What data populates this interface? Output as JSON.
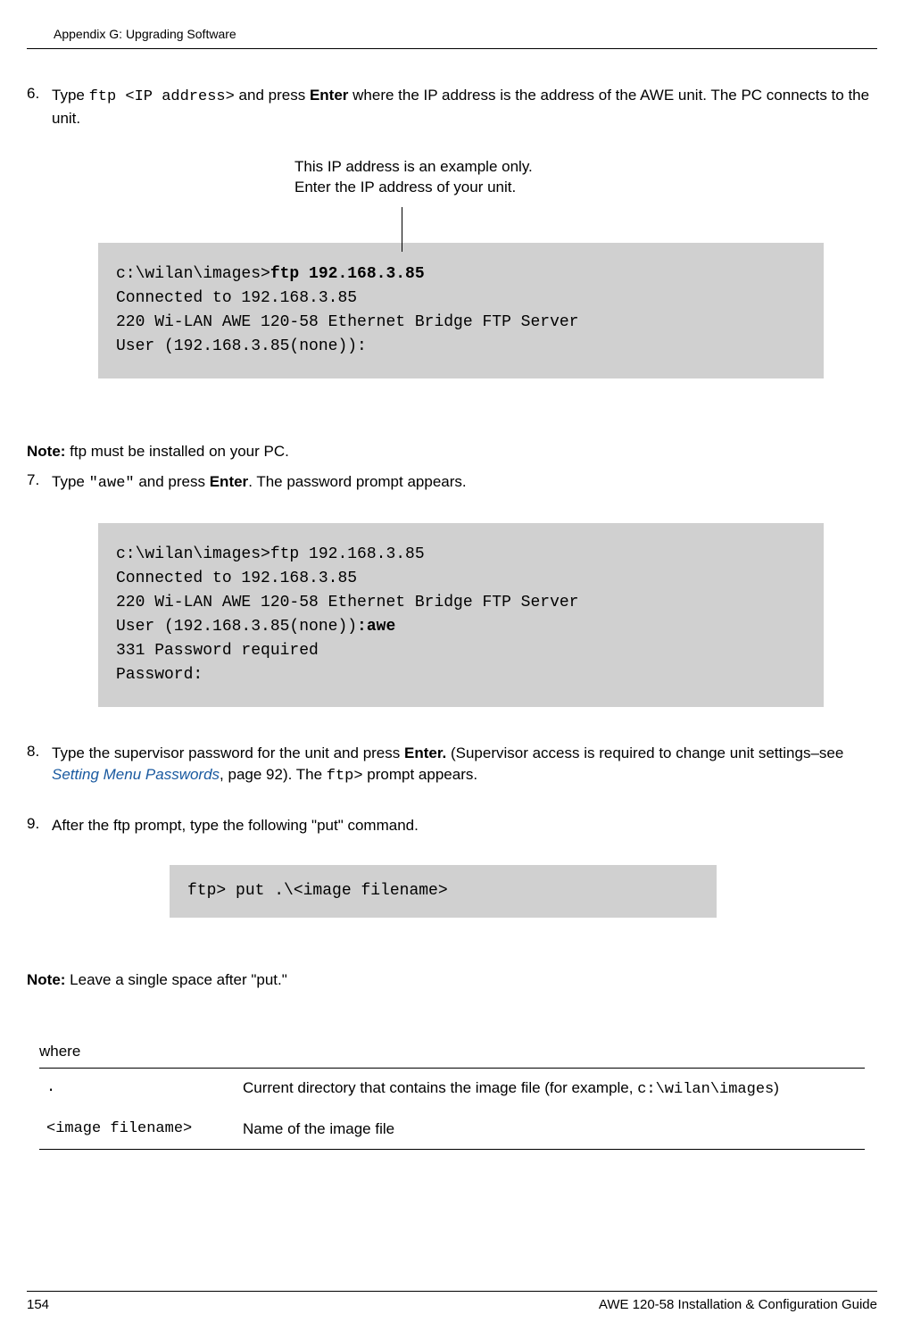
{
  "header": {
    "title": "Appendix G: Upgrading Software"
  },
  "step6": {
    "num": "6.",
    "text_before": "Type ",
    "code": "ftp <IP address>",
    "text_mid": " and press ",
    "bold": "Enter",
    "text_after": " where the IP address is the address of the AWE unit. The PC connects to the unit."
  },
  "callout": {
    "line1": "This IP address is an example only.",
    "line2": "Enter the IP address of your unit."
  },
  "code1": {
    "prefix": "c:\\wilan\\images>",
    "cmd": "ftp 192.168.3.85",
    "l2": "Connected to 192.168.3.85",
    "l3": "220 Wi-LAN AWE 120-58 Ethernet Bridge FTP Server",
    "l4": "User (192.168.3.85(none)):"
  },
  "note1": {
    "bold": "Note:",
    "text": " ftp must be installed on your PC."
  },
  "step7": {
    "num": "7.",
    "text_before": "Type ",
    "code": "\"awe\"",
    "text_mid": " and press ",
    "bold": "Enter",
    "text_after": ". The password prompt appears."
  },
  "code2": {
    "l1": "c:\\wilan\\images>ftp 192.168.3.85",
    "l2": "Connected to 192.168.3.85",
    "l3": "220 Wi-LAN AWE 120-58 Ethernet Bridge FTP Server",
    "l4a": "User (192.168.3.85(none))",
    "l4b": ":awe",
    "l5": "331 Password required",
    "l6": "Password:"
  },
  "step8": {
    "num": "8.",
    "text_before": "Type the supervisor password for the unit and press ",
    "bold": "Enter.",
    "text_mid1": " (Supervisor access is required to change unit settings–see ",
    "link": "Setting Menu Passwords",
    "text_mid2": ", page 92). The ",
    "code": "ftp>",
    "text_after": " prompt appears."
  },
  "step9": {
    "num": "9.",
    "text": "After the ftp prompt, type the following \"put\" command."
  },
  "code3": {
    "prefix": "ftp> ",
    "cmd": "put",
    "suffix": " .\\<image filename>"
  },
  "note2": {
    "bold": "Note:",
    "text": " Leave a single space after \"put.\""
  },
  "where": "where",
  "table": {
    "r1c1": " .",
    "r1c2a": "Current directory that contains the image file (for example, ",
    "r1c2b": "c:\\wilan\\images",
    "r1c2c": ")",
    "r2c1": "<image filename>",
    "r2c2": "Name of the image file"
  },
  "footer": {
    "page": "154",
    "doc": "AWE 120-58 Installation & Configuration Guide"
  }
}
